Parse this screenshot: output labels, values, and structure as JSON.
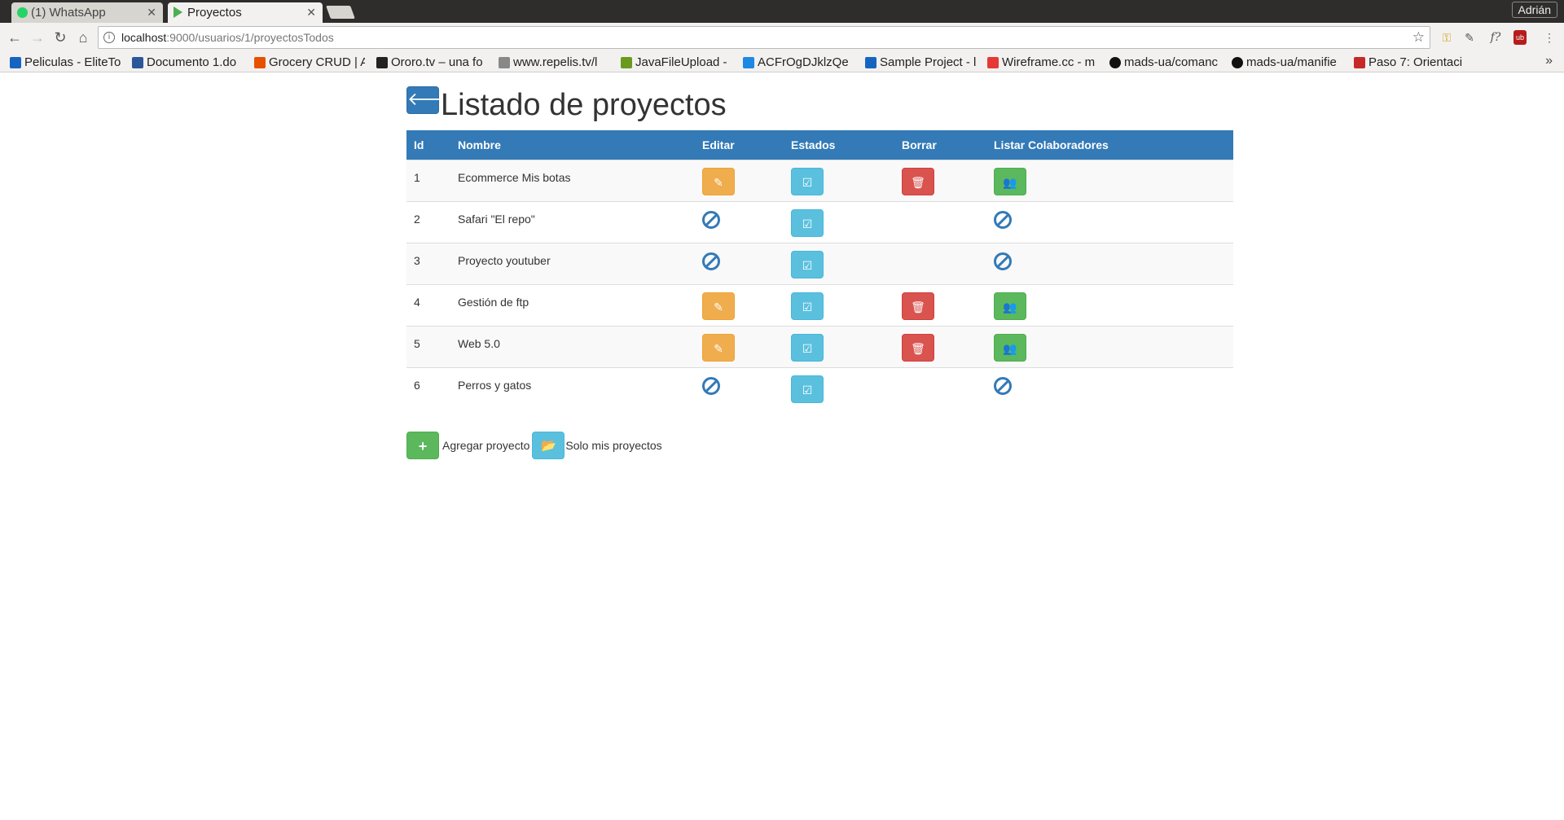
{
  "browser": {
    "tabs": [
      {
        "label": "(1) WhatsApp",
        "active": false
      },
      {
        "label": "Proyectos",
        "active": true
      }
    ],
    "profile_name": "Adrián",
    "url_host": "localhost",
    "url_rest": ":9000/usuarios/1/proyectosTodos",
    "bookmarks": [
      {
        "label": "Peliculas - EliteTo",
        "icon_color": "#1565c0"
      },
      {
        "label": "Documento 1.do",
        "icon_color": "#2b579a"
      },
      {
        "label": "Grocery CRUD | A",
        "icon_color": "#e65100"
      },
      {
        "label": "Ororo.tv – una fo",
        "icon_color": "#222222"
      },
      {
        "label": "www.repelis.tv/l",
        "icon_color": "#888888"
      },
      {
        "label": "JavaFileUpload -",
        "icon_color": "#6a9a1e"
      },
      {
        "label": "ACFrOgDJklzQe",
        "icon_color": "#1e88e5"
      },
      {
        "label": "Sample Project - l",
        "icon_color": "#1565c0"
      },
      {
        "label": "Wireframe.cc - m",
        "icon_color": "#e53935"
      },
      {
        "label": "mads-ua/comanc",
        "icon_color": "#111111"
      },
      {
        "label": "mads-ua/manifie",
        "icon_color": "#111111"
      },
      {
        "label": "Paso 7: Orientaci",
        "icon_color": "#c62828"
      }
    ],
    "bookmarks_overflow": "»"
  },
  "page": {
    "title": "Listado de proyectos",
    "columns": [
      "Id",
      "Nombre",
      "Editar",
      "Estados",
      "Borrar",
      "Listar Colaboradores"
    ],
    "rows": [
      {
        "id": "1",
        "name": "Ecommerce Mis botas",
        "editable": true
      },
      {
        "id": "2",
        "name": "Safari \"El repo\"",
        "editable": false
      },
      {
        "id": "3",
        "name": "Proyecto youtuber",
        "editable": false
      },
      {
        "id": "4",
        "name": "Gestión de ftp",
        "editable": true
      },
      {
        "id": "5",
        "name": "Web 5.0",
        "editable": true
      },
      {
        "id": "6",
        "name": "Perros y gatos",
        "editable": false
      }
    ],
    "add_project_label": "Agregar proyecto",
    "my_projects_label": "Solo mis proyectos"
  },
  "colors": {
    "primary": "#337ab7",
    "warning": "#f0ad4e",
    "info": "#5bc0de",
    "danger": "#d9534f",
    "success": "#5cb85c"
  },
  "icons": {
    "back": "arrow-left-icon",
    "edit": "pencil-icon",
    "states": "edit-square-icon",
    "delete": "trash-icon",
    "collaborators": "users-icon",
    "disabled": "ban-icon",
    "add": "plus-icon",
    "folder": "folder-open-icon"
  }
}
